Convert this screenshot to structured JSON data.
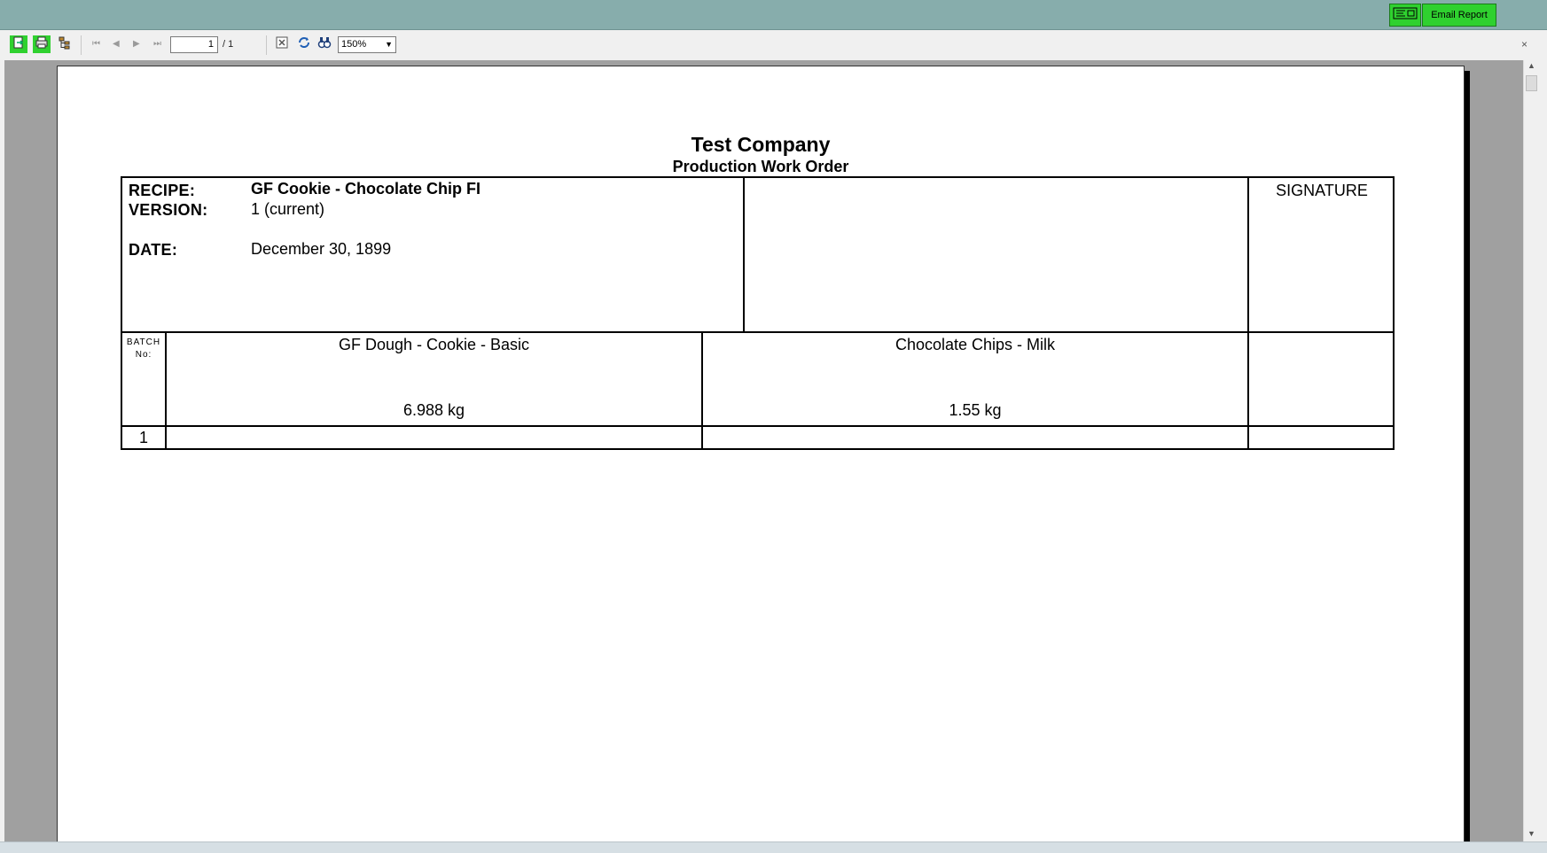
{
  "header": {
    "email_button_label": "Email Report",
    "email_icon": "email-icon"
  },
  "toolbar": {
    "icons": [
      "export-icon",
      "print-icon",
      "group-tree-icon",
      "first-page-icon",
      "previous-page-icon",
      "next-page-icon",
      "last-page-icon",
      "stop-icon",
      "refresh-icon",
      "search-icon"
    ],
    "current_page": "1",
    "page_total": "/ 1",
    "zoom": "150%",
    "close_glyph": "×"
  },
  "report": {
    "company": "Test Company",
    "title": "Production Work Order",
    "recipe_label": "RECIPE:",
    "recipe_value": "GF Cookie - Chocolate Chip FI",
    "version_label": "VERSION:",
    "version_value": "1 (current)",
    "date_label": "DATE:",
    "date_value": "December 30, 1899",
    "signature_label": "SIGNATURE",
    "batch_label_line1": "BATCH",
    "batch_label_line2": "No:",
    "ingredients": [
      {
        "name": "GF Dough - Cookie - Basic",
        "amount": "6.988 kg"
      },
      {
        "name": "Chocolate Chips - Milk",
        "amount": "1.55 kg"
      }
    ],
    "batches": [
      "1"
    ]
  },
  "colors": {
    "title_bar": "#87adac",
    "accent_green": "#2fd12f",
    "viewer_bg": "#a0a0a0"
  }
}
